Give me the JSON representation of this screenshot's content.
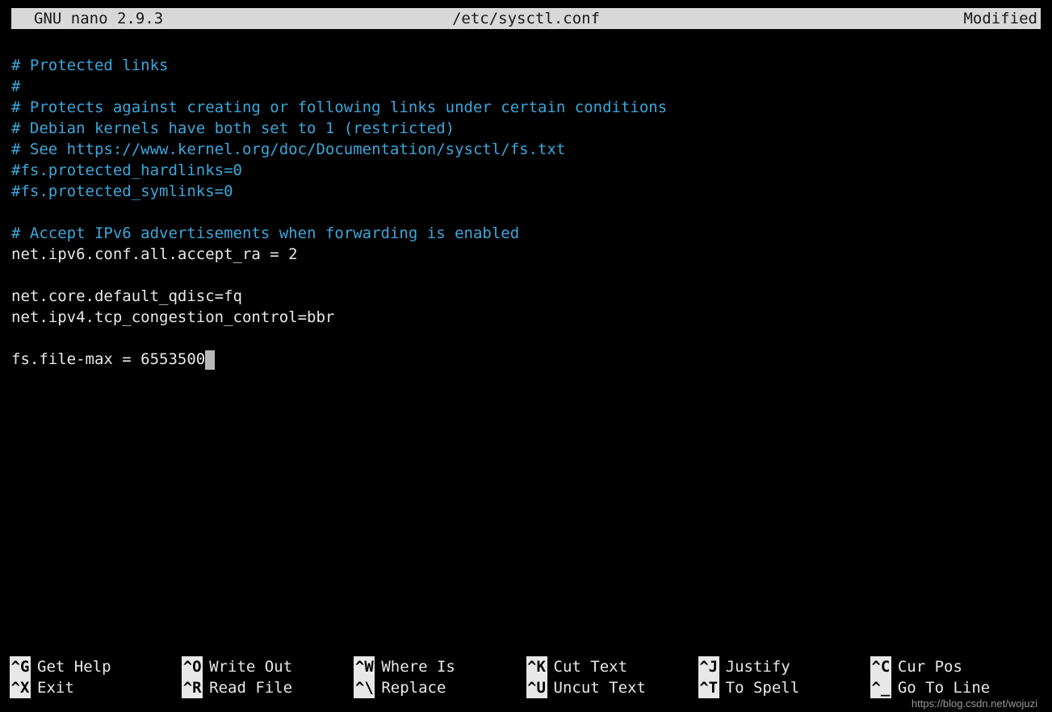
{
  "titlebar": {
    "app": "GNU nano 2.9.3",
    "file": "/etc/sysctl.conf",
    "status": "Modified"
  },
  "lines": [
    {
      "cls": "comment",
      "text": "# Protected links"
    },
    {
      "cls": "comment",
      "text": "#"
    },
    {
      "cls": "comment",
      "text": "# Protects against creating or following links under certain conditions"
    },
    {
      "cls": "comment",
      "text": "# Debian kernels have both set to 1 (restricted)"
    },
    {
      "cls": "comment",
      "text": "# See https://www.kernel.org/doc/Documentation/sysctl/fs.txt"
    },
    {
      "cls": "comment",
      "text": "#fs.protected_hardlinks=0"
    },
    {
      "cls": "comment",
      "text": "#fs.protected_symlinks=0"
    },
    {
      "cls": "plain",
      "text": ""
    },
    {
      "cls": "comment",
      "text": "# Accept IPv6 advertisements when forwarding is enabled"
    },
    {
      "cls": "plain",
      "text": "net.ipv6.conf.all.accept_ra = 2"
    },
    {
      "cls": "plain",
      "text": ""
    },
    {
      "cls": "plain",
      "text": "net.core.default_qdisc=fq"
    },
    {
      "cls": "plain",
      "text": "net.ipv4.tcp_congestion_control=bbr"
    },
    {
      "cls": "plain",
      "text": ""
    },
    {
      "cls": "plain",
      "text": "fs.file-max = 6553500",
      "cursor": true
    }
  ],
  "shortcuts": [
    {
      "key": "^G",
      "label": "Get Help"
    },
    {
      "key": "^O",
      "label": "Write Out"
    },
    {
      "key": "^W",
      "label": "Where Is"
    },
    {
      "key": "^K",
      "label": "Cut Text"
    },
    {
      "key": "^J",
      "label": "Justify"
    },
    {
      "key": "^C",
      "label": "Cur Pos"
    },
    {
      "key": "^X",
      "label": "Exit"
    },
    {
      "key": "^R",
      "label": "Read File"
    },
    {
      "key": "^\\",
      "label": "Replace"
    },
    {
      "key": "^U",
      "label": "Uncut Text"
    },
    {
      "key": "^T",
      "label": "To Spell"
    },
    {
      "key": "^_",
      "label": "Go To Line"
    }
  ],
  "watermark": "https://blog.csdn.net/wojuzi"
}
